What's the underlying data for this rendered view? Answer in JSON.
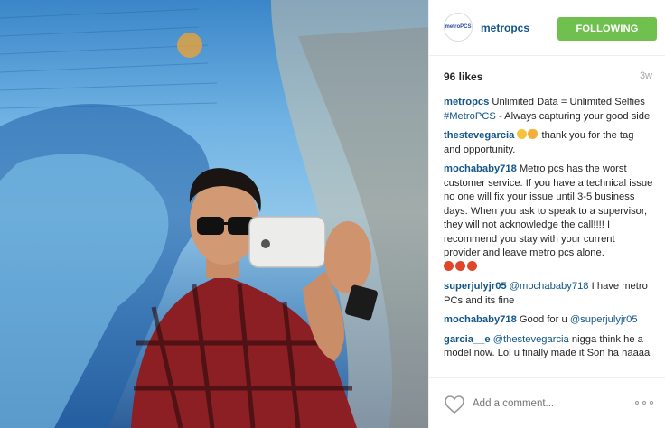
{
  "post": {
    "photo_alt": "",
    "author": {
      "username": "metropcs",
      "avatar_text": "metroPCS",
      "follow_label": "FOLLOWING"
    },
    "likes": "96 likes",
    "time_ago": "3w",
    "caption": {
      "user": "metropcs",
      "text": "Unlimited Data = Unlimited Selfies",
      "hashtag": "#MetroPCS",
      "text_after": "- Always capturing your good side"
    },
    "comments": [
      {
        "user": "thestevegarcia",
        "emoji_before": [
          "grinning-face",
          "ok-hand"
        ],
        "text": "thank you for the tag and opportunity."
      },
      {
        "user": "mochababy718",
        "text": "Metro pcs has the worst customer service. If you have a technical issue no one will fix your issue until 3-5 business days. When you ask to speak to a supervisor, they will not acknowledge the call!!!! I recommend you stay with your current provider and leave metro pcs alone.",
        "emoji_after": [
          "angry-face",
          "angry-face",
          "angry-face"
        ]
      },
      {
        "user": "superjulyjr05",
        "mention": "@mochababy718",
        "text": "I have metro PCs and its fine"
      },
      {
        "user": "mochababy718",
        "text_before": "Good for u",
        "mention": "@superjulyjr05"
      },
      {
        "user": "garcia__e",
        "mention": "@thestevegarcia",
        "text": "nigga think he a model now. Lol u finally made it Son ha haaaa"
      }
    ],
    "add_comment_placeholder": "Add a comment...",
    "icons": {
      "like": "heart-outline-icon",
      "more": "more-options-icon"
    },
    "colors": {
      "link": "#125688",
      "follow_button": "#70c050",
      "muted": "#a5a7aa"
    }
  }
}
